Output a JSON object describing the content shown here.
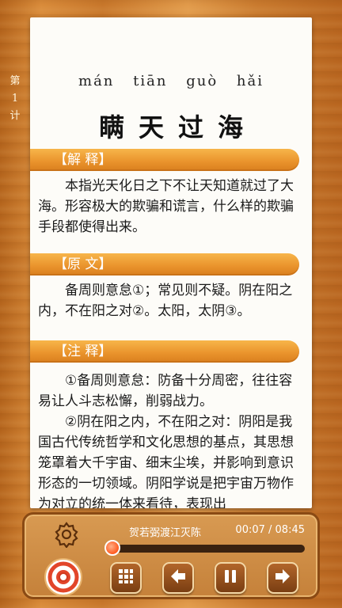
{
  "side_label": [
    "第",
    "1",
    "计"
  ],
  "pinyin": [
    "mán",
    "tiān",
    "guò",
    "hǎi"
  ],
  "title": "瞒天过海",
  "sections": [
    {
      "heading": "【解 释】",
      "paragraphs": [
        "本指光天化日之下不让天知道就过了大海。形容极大的欺骗和谎言，什么样的欺骗手段都使得出来。"
      ]
    },
    {
      "heading": "【原 文】",
      "paragraphs": [
        "备周则意怠①；常见则不疑。阴在阳之内，不在阳之对②。太阳，太阴③。"
      ]
    },
    {
      "heading": "【注 释】",
      "paragraphs": [
        "①备周则意怠：防备十分周密，往往容易让人斗志松懈，削弱战力。",
        "②阴在阳之内，不在阳之对：阴阳是我国古代传统哲学和文化思想的基点，其思想笼罩着大千宇宙、细末尘埃，并影响到意识形态的一切领域。阴阳学说是把宇宙万物作为对立的统一体来看待，表现出"
      ]
    }
  ],
  "player": {
    "track_name": "贺若弼渡江灭陈",
    "time": "00:07 / 08:45",
    "progress": 0.013
  },
  "icons": {
    "settings": "gear-icon",
    "disc": "disc-icon",
    "menu": "grid-icon",
    "prev": "arrow-left-icon",
    "pause": "pause-icon",
    "next": "arrow-right-icon"
  }
}
